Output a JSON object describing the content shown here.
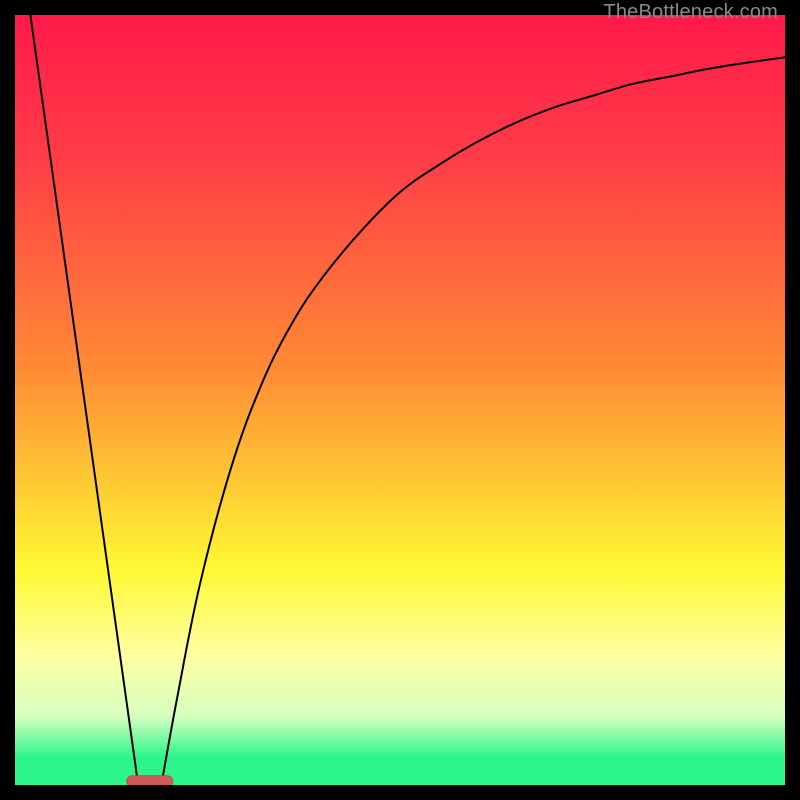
{
  "watermark": "TheBottleneck.com",
  "colors": {
    "black": "#000000",
    "curve": "#000000",
    "marker_fill": "#d05a5a",
    "marker_stroke": "#c04848",
    "grad_top": "#ff1a49",
    "grad_red": "#ff3b47",
    "grad_orange": "#ff8b35",
    "grad_yellow": "#fff833",
    "grad_paleyellow": "#ffffa0",
    "grad_lightgreen": "#d8ffc0",
    "grad_green": "#2cf58a"
  },
  "chart_data": {
    "type": "line",
    "title": "",
    "xlabel": "",
    "ylabel": "",
    "xlim": [
      0,
      100
    ],
    "ylim": [
      0,
      100
    ],
    "series": [
      {
        "name": "left-line",
        "x": [
          2,
          16
        ],
        "y": [
          100,
          0
        ]
      },
      {
        "name": "right-curve",
        "x": [
          19,
          21,
          24,
          28,
          32,
          36,
          40,
          45,
          50,
          55,
          60,
          65,
          70,
          75,
          80,
          85,
          90,
          95,
          100
        ],
        "y": [
          0,
          11,
          26,
          41,
          52,
          60,
          66,
          72,
          77,
          80.5,
          83.5,
          86,
          88,
          89.5,
          91,
          92,
          93,
          93.8,
          94.5
        ]
      }
    ],
    "marker": {
      "x": 17.5,
      "y": 0.5,
      "width": 6,
      "height": 1.4
    },
    "gradient_stops": [
      {
        "offset": 0.0,
        "color": "#ff1a49"
      },
      {
        "offset": 0.18,
        "color": "#ff3b47"
      },
      {
        "offset": 0.46,
        "color": "#ff8b35"
      },
      {
        "offset": 0.72,
        "color": "#fff833"
      },
      {
        "offset": 0.83,
        "color": "#ffffa0"
      },
      {
        "offset": 0.91,
        "color": "#d8ffc0"
      },
      {
        "offset": 0.965,
        "color": "#2cf58a"
      },
      {
        "offset": 1.0,
        "color": "#2cf58a"
      }
    ]
  }
}
